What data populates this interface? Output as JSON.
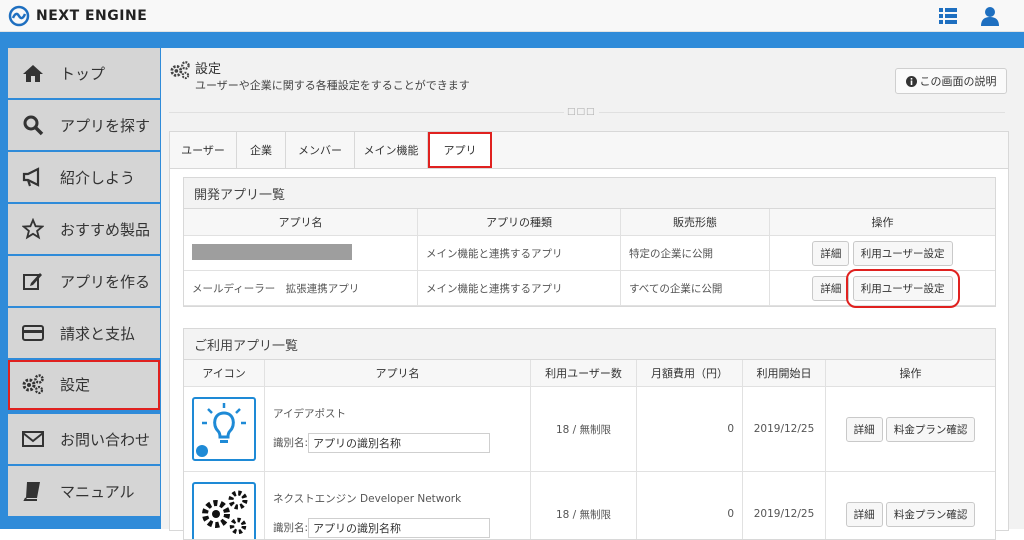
{
  "header": {
    "brand": "NEXT ENGINE",
    "icons": [
      "list-icon",
      "user-icon"
    ]
  },
  "sidebar": {
    "items": [
      {
        "label": "トップ",
        "icon": "home-icon"
      },
      {
        "label": "アプリを探す",
        "icon": "search-icon"
      },
      {
        "label": "紹介しよう",
        "icon": "megaphone-icon"
      },
      {
        "label": "おすすめ製品",
        "icon": "star-icon"
      },
      {
        "label": "アプリを作る",
        "icon": "edit-icon"
      },
      {
        "label": "請求と支払",
        "icon": "credit-card-icon"
      },
      {
        "label": "設定",
        "icon": "gears-icon"
      },
      {
        "label": "お問い合わせ",
        "icon": "envelope-icon"
      },
      {
        "label": "マニュアル",
        "icon": "book-icon"
      }
    ],
    "active_index": 6
  },
  "page": {
    "title": "設定",
    "subtitle": "ユーザーや企業に関する各種設定をすることができます",
    "help_button": "この画面の説明"
  },
  "tabs": [
    "ユーザー",
    "企業",
    "メンバー",
    "メイン機能",
    "アプリ"
  ],
  "active_tab": "アプリ",
  "dev_apps": {
    "title": "開発アプリ一覧",
    "columns": [
      "アプリ名",
      "アプリの種類",
      "販売形態",
      "操作"
    ],
    "rows": [
      {
        "name": "",
        "type": "メイン機能と連携するアプリ",
        "sales": "特定の企業に公開",
        "btn1": "詳細",
        "btn2": "利用ユーザー設定"
      },
      {
        "name": "メールディーラー　拡張連携アプリ",
        "type": "メイン機能と連携するアプリ",
        "sales": "すべての企業に公開",
        "btn1": "詳細",
        "btn2": "利用ユーザー設定"
      }
    ]
  },
  "used_apps": {
    "title": "ご利用アプリ一覧",
    "columns": [
      "アイコン",
      "アプリ名",
      "利用ユーザー数",
      "月額費用（円）",
      "利用開始日",
      "操作"
    ],
    "rows": [
      {
        "name": "アイデアポスト",
        "id_label": "識別名:",
        "id_value": "アプリの識別名称",
        "users": "18 / 無制限",
        "fee": "0",
        "date": "2019/12/25",
        "btn1": "詳細",
        "btn2": "料金プラン確認"
      },
      {
        "name": "ネクストエンジン Developer Network",
        "id_label": "識別名:",
        "id_value": "アプリの識別名称",
        "users": "18 / 無制限",
        "fee": "0",
        "date": "2019/12/25",
        "btn1": "詳細",
        "btn2": "料金プラン確認"
      }
    ]
  },
  "colors": {
    "brand_blue": "#2f8bd9",
    "highlight_red": "#e0211f"
  }
}
